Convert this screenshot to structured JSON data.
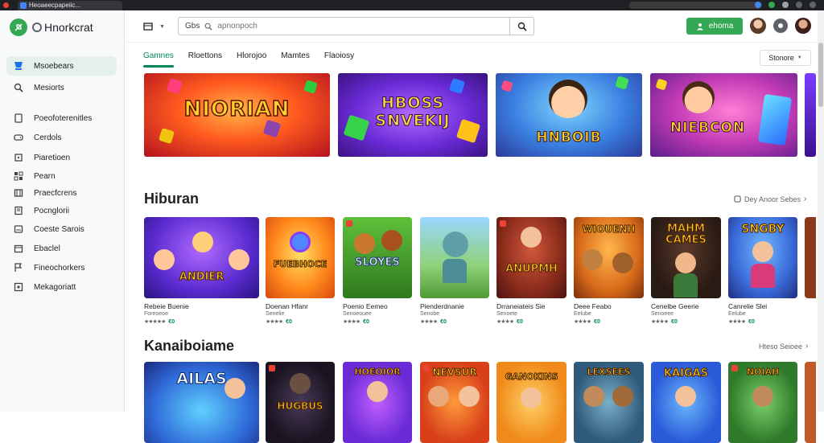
{
  "browser": {
    "tab_title": "Heoaeecpapeiic..."
  },
  "brand": {
    "name": "Hnorkcrat",
    "accent": "#34a853"
  },
  "sidebar": {
    "items": [
      {
        "label": "Msoebears",
        "icon": "store-icon",
        "active": true
      },
      {
        "label": "Mesiorts",
        "icon": "search-icon"
      },
      {
        "label": "Poeofoterenitles",
        "icon": "tablet-icon"
      },
      {
        "label": "Cerdols",
        "icon": "gamepad-icon"
      },
      {
        "label": "Piaretioen",
        "icon": "puzzle-icon"
      },
      {
        "label": "Pearn",
        "icon": "grid-icon"
      },
      {
        "label": "Praecfcrens",
        "icon": "film-icon"
      },
      {
        "label": "Pocnglorii",
        "icon": "book-icon"
      },
      {
        "label": "Coeste Sarois",
        "icon": "car-icon"
      },
      {
        "label": "Ebaclel",
        "icon": "shop-icon"
      },
      {
        "label": "Fineochorkers",
        "icon": "flag-icon"
      },
      {
        "label": "Mekagoriatt",
        "icon": "settings-icon"
      }
    ]
  },
  "topbar": {
    "search_prefix": "Gbs",
    "search_placeholder": "apnonpoch",
    "signin_label": "ehoma"
  },
  "tabs": [
    {
      "label": "Gamnes",
      "active": true
    },
    {
      "label": "Rloettons"
    },
    {
      "label": "Hlorojoo"
    },
    {
      "label": "Mamtes"
    },
    {
      "label": "Flaoiosy"
    }
  ],
  "sort": {
    "label": "Stonore"
  },
  "banners": [
    {
      "title": "NIORIAN"
    },
    {
      "title": "HBOSS SNVEKIJ"
    },
    {
      "title": "HNBOIB"
    },
    {
      "title": "NIEBCON"
    }
  ],
  "section1": {
    "title": "Hiburan",
    "more": "Dey Anoor Sebes",
    "tiles": [
      {
        "art_title": "ANDIER",
        "name": "Rebeie Buenie",
        "sub": "Foreoeoe",
        "stars": "★★★★★",
        "price": "€0"
      },
      {
        "art_title": "FUEBHOCE",
        "name": "Doenan Hfanr",
        "sub": "Senelie",
        "stars": "★★★★",
        "price": "€0"
      },
      {
        "art_title": "SLOYES",
        "name": "Poenio Eemeo",
        "sub": "Senoeouee",
        "stars": "★★★★",
        "price": "€0"
      },
      {
        "art_title": "",
        "name": "Pienderdnanie",
        "sub": "Senobe",
        "stars": "★★★★",
        "price": "€0"
      },
      {
        "art_title": "ANUPMH",
        "name": "Drraneiateis Sie",
        "sub": "Senoete",
        "stars": "★★★★",
        "price": "€0"
      },
      {
        "art_title": "WIOUENH",
        "name": "Deee Feabo",
        "sub": "Eelube",
        "stars": "★★★★",
        "price": "€0"
      },
      {
        "art_title": "MAHM CAMES",
        "name": "Cenelbe Geerie",
        "sub": "Senoeee",
        "stars": "★★★★",
        "price": "€0"
      },
      {
        "art_title": "SNGBY",
        "name": "Canrelie Slei",
        "sub": "Eelube",
        "stars": "★★★★",
        "price": "€0"
      }
    ]
  },
  "section2": {
    "title": "Kanaiboiame",
    "more": "Hteso Seioee",
    "tiles": [
      {
        "art_title": "AILAS"
      },
      {
        "art_title": "HUGBUS"
      },
      {
        "art_title": "HOEOIOR"
      },
      {
        "art_title": "NEVSUR"
      },
      {
        "art_title": "GANOKINS"
      },
      {
        "art_title": "LEXSEES"
      },
      {
        "art_title": "KAIGAS"
      },
      {
        "art_title": "NOIAH"
      }
    ]
  }
}
